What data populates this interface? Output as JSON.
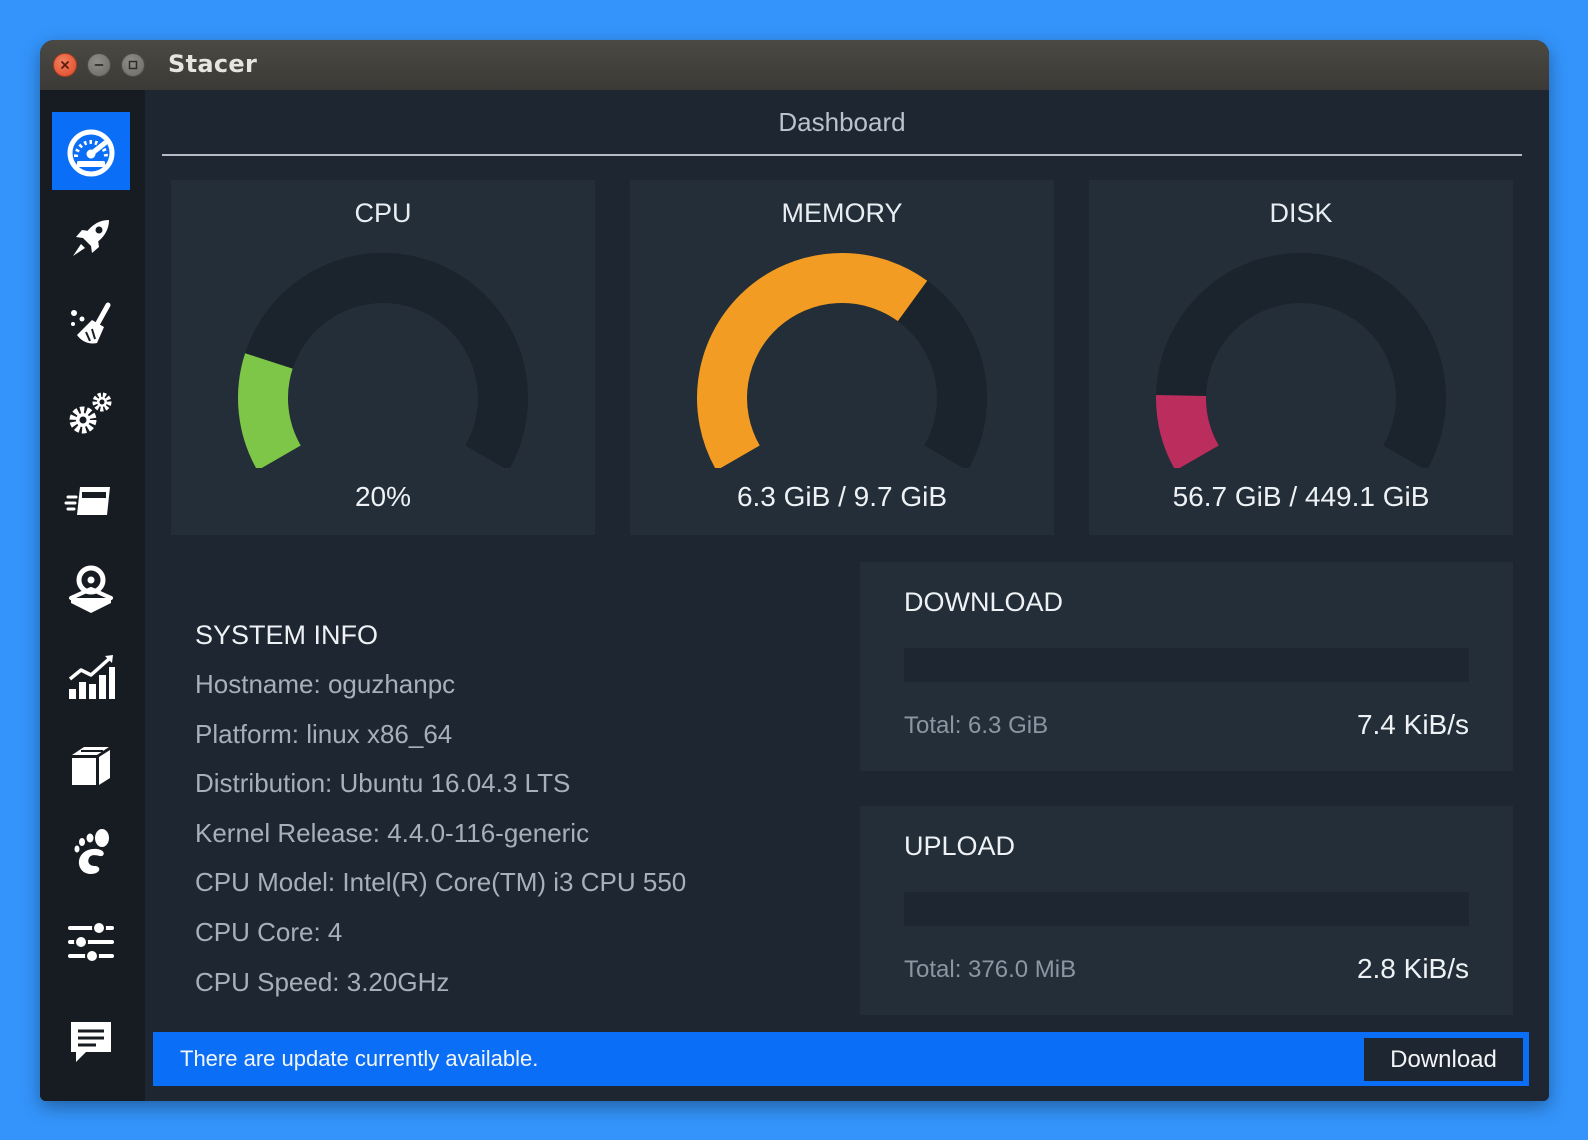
{
  "window": {
    "title": "Stacer"
  },
  "sidebar": {
    "items": [
      {
        "icon": "dashboard-gauge-icon",
        "active": true
      },
      {
        "icon": "rocket-startup-icon"
      },
      {
        "icon": "broom-cleaner-icon"
      },
      {
        "icon": "gears-services-icon"
      },
      {
        "icon": "processes-icon"
      },
      {
        "icon": "uninstaller-icon"
      },
      {
        "icon": "resources-chart-icon"
      },
      {
        "icon": "package-box-icon"
      },
      {
        "icon": "gnome-foot-icon"
      },
      {
        "icon": "sliders-settings-icon"
      },
      {
        "icon": "feedback-message-icon"
      }
    ]
  },
  "main": {
    "title": "Dashboard",
    "gauges": [
      {
        "title": "CPU",
        "value": "20%",
        "fraction": 0.2,
        "color": "#7dc647"
      },
      {
        "title": "MEMORY",
        "value": "6.3 GiB / 9.7 GiB",
        "fraction": 0.65,
        "color": "#f39c24"
      },
      {
        "title": "DISK",
        "value": "56.7 GiB / 449.1 GiB",
        "fraction": 0.13,
        "color": "#ba2d5c"
      }
    ],
    "system_info": {
      "title": "SYSTEM INFO",
      "rows": [
        "Hostname: oguzhanpc",
        "Platform: linux x86_64",
        "Distribution: Ubuntu 16.04.3 LTS",
        "Kernel Release: 4.4.0-116-generic",
        "CPU Model: Intel(R) Core(TM) i3 CPU 550",
        "CPU Core: 4",
        "CPU Speed: 3.20GHz"
      ]
    },
    "download": {
      "title": "DOWNLOAD",
      "total": "Total: 6.3 GiB",
      "speed": "7.4 KiB/s",
      "fraction": 0
    },
    "upload": {
      "title": "UPLOAD",
      "total": "Total: 376.0 MiB",
      "speed": "2.8 KiB/s",
      "fraction": 0
    }
  },
  "update_bar": {
    "message": "There are update currently available.",
    "button": "Download"
  },
  "colors": {
    "accent": "#0b6ef7",
    "background": "#1e2731",
    "card": "#232e39",
    "gauge_track": "#1b232c"
  }
}
